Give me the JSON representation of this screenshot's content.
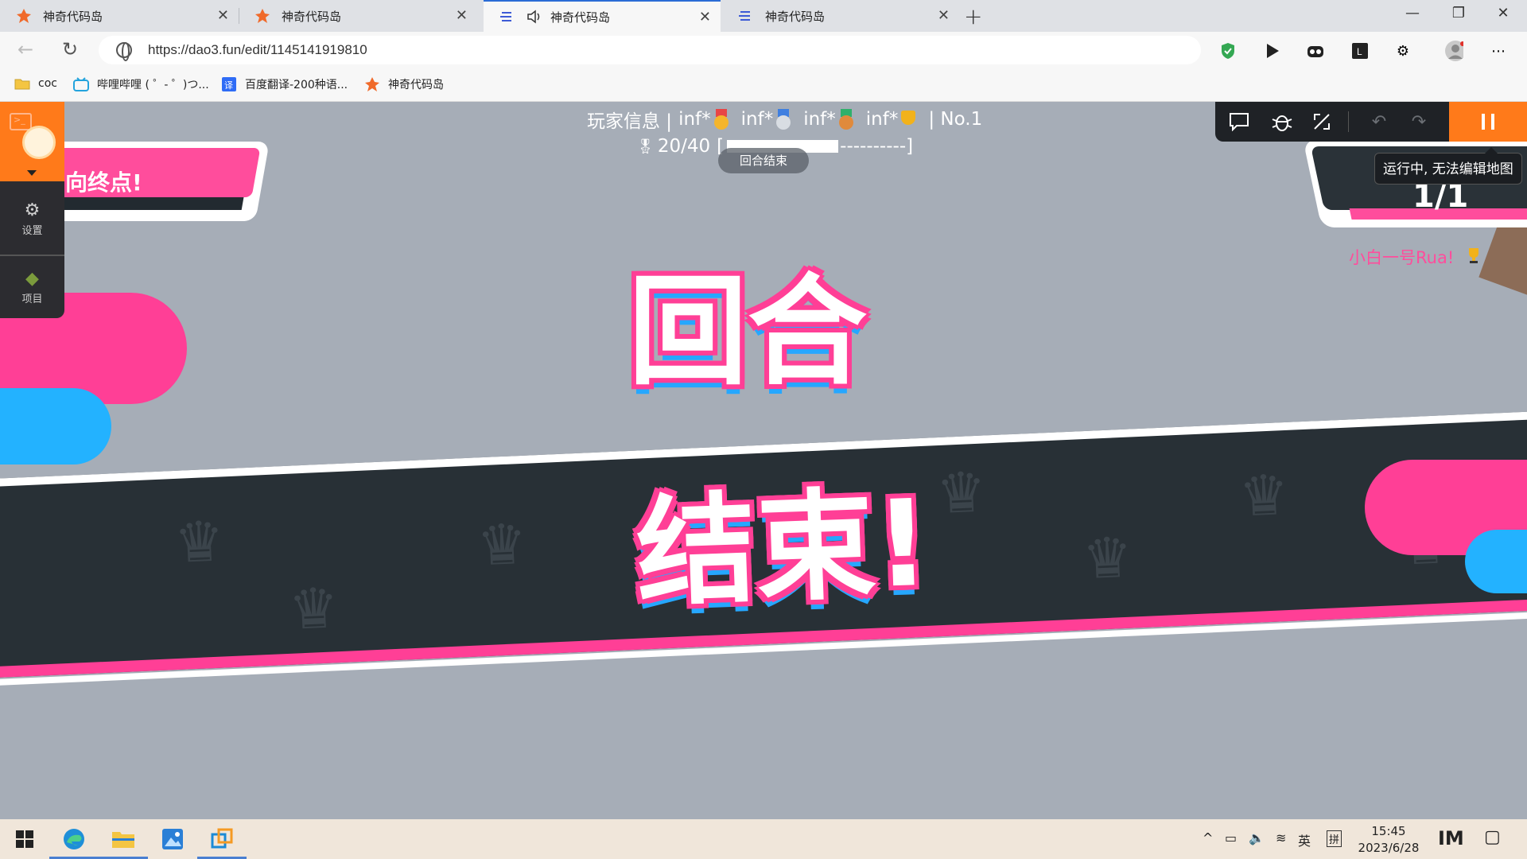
{
  "browser": {
    "tabs": [
      {
        "title": "神奇代码岛",
        "icon": "dao3-logo-icon"
      },
      {
        "title": "神奇代码岛",
        "icon": "dao3-logo-icon"
      },
      {
        "title": "神奇代码岛",
        "icon": "dao3-editor-icon",
        "audio": true,
        "active": true
      },
      {
        "title": "神奇代码岛",
        "icon": "dao3-editor-icon"
      }
    ],
    "url": "https://dao3.fun/edit/1145141919810",
    "bookmarks": [
      {
        "label": "coc",
        "icon": "folder-icon"
      },
      {
        "label": "哔哩哔哩 ( ゜- ゜)つ...",
        "icon": "bilibili-icon"
      },
      {
        "label": "百度翻译-200种语...",
        "icon": "baidu-translate-icon"
      },
      {
        "label": "神奇代码岛",
        "icon": "dao3-logo-icon"
      }
    ]
  },
  "game": {
    "player_info": {
      "prefix": "玩家信息 |",
      "stats": [
        "inf*",
        "inf*",
        "inf*",
        "inf*"
      ],
      "rank": "| No.1"
    },
    "progress": {
      "text": "20/40",
      "bar_fraction": 0.5,
      "suffix": "----------]"
    },
    "toast": "回合结束",
    "banner_text": "回合结束!",
    "banner_line1": "回合",
    "banner_line2": "结束!",
    "goal_text": "向终点!",
    "round_counter": "1/1",
    "player_name": "小白一号Rua!",
    "dock": {
      "settings": "设置",
      "project": "项目"
    },
    "tooltip": "运行中, 无法编辑地图"
  },
  "taskbar": {
    "ime": "英",
    "ime2": "拼",
    "time": "15:45",
    "date": "2023/6/28"
  },
  "colors": {
    "accent_orange": "#ff7a1a",
    "brand_pink": "#ff3f96",
    "band_dark": "#283036",
    "sky_grey": "#a6adb7"
  }
}
